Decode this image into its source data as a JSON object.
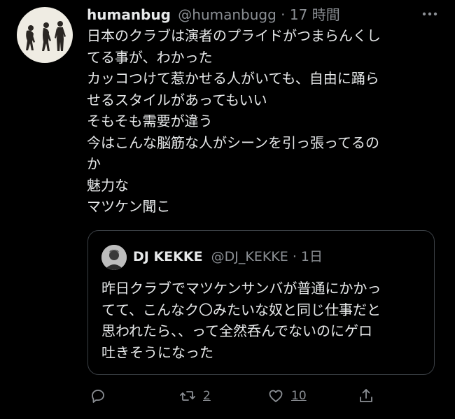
{
  "tweet": {
    "author_name": "humanbug",
    "author_handle": "@humanbugg",
    "separator": "·",
    "time": "17 時間",
    "lines": [
      "日本のクラブは演者のプライドがつまらんくし",
      "てる事が、わかった",
      "カッコつけて惹かせる人がいても、自由に踊ら",
      "せるスタイルがあってもいい",
      "そもそも需要が違う",
      "今はこんな脳筋な人がシーンを引っ張ってるの",
      "か",
      "魅力な",
      "マツケン聞こ"
    ]
  },
  "quote": {
    "author_name": "DJ KEKKE",
    "author_handle": "@DJ_KEKKE",
    "separator": "·",
    "time": "1日",
    "lines": [
      "昨日クラブでマツケンサンバが普通にかかっ",
      "てて、こんなク〇みたいな奴と同じ仕事だと",
      "思われたら、、って全然呑んでないのにゲロ",
      "吐きそうになった"
    ]
  },
  "actions": {
    "retweet_count": "2",
    "like_count": "10"
  },
  "icons": {
    "reply": "reply-icon",
    "retweet": "retweet-icon",
    "like": "heart-icon",
    "share": "share-icon",
    "more": "more-icon"
  },
  "colors": {
    "background": "#000000",
    "text": "#e7e9ea",
    "muted": "#8b8f94",
    "border": "#3a3f44"
  }
}
